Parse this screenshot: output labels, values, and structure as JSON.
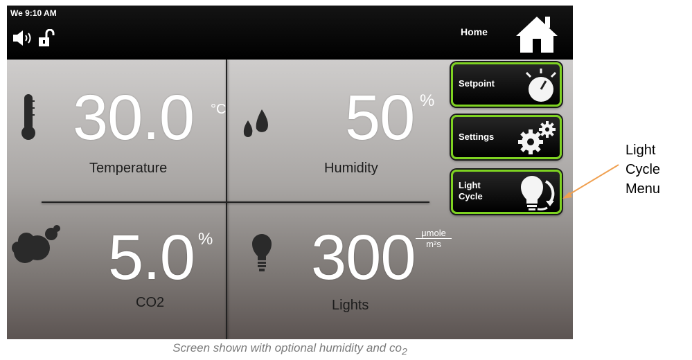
{
  "status_bar": {
    "clock": "We 9:10 AM",
    "home_label": "Home"
  },
  "readings": {
    "temperature": {
      "value": "30.0",
      "unit": "°C",
      "label": "Temperature"
    },
    "humidity": {
      "value": "50",
      "unit": "%",
      "label": "Humidity"
    },
    "co2": {
      "value": "5.0",
      "unit": "%",
      "label": "CO2"
    },
    "lights": {
      "value": "300",
      "unit_num": "μmole",
      "unit_den": "m²s",
      "label": "Lights"
    }
  },
  "menu": {
    "setpoint": "Setpoint",
    "settings": "Settings",
    "light_cycle_line1": "Light",
    "light_cycle_line2": "Cycle"
  },
  "annotation": {
    "line1": "Light",
    "line2": "Cycle",
    "line3": "Menu"
  },
  "caption": {
    "text": "Screen shown with optional humidity and co",
    "subscript": "2"
  },
  "colors": {
    "button_border": "#7ed321",
    "annotation_arrow": "#f0a050",
    "caption": "#7a7a7a"
  }
}
